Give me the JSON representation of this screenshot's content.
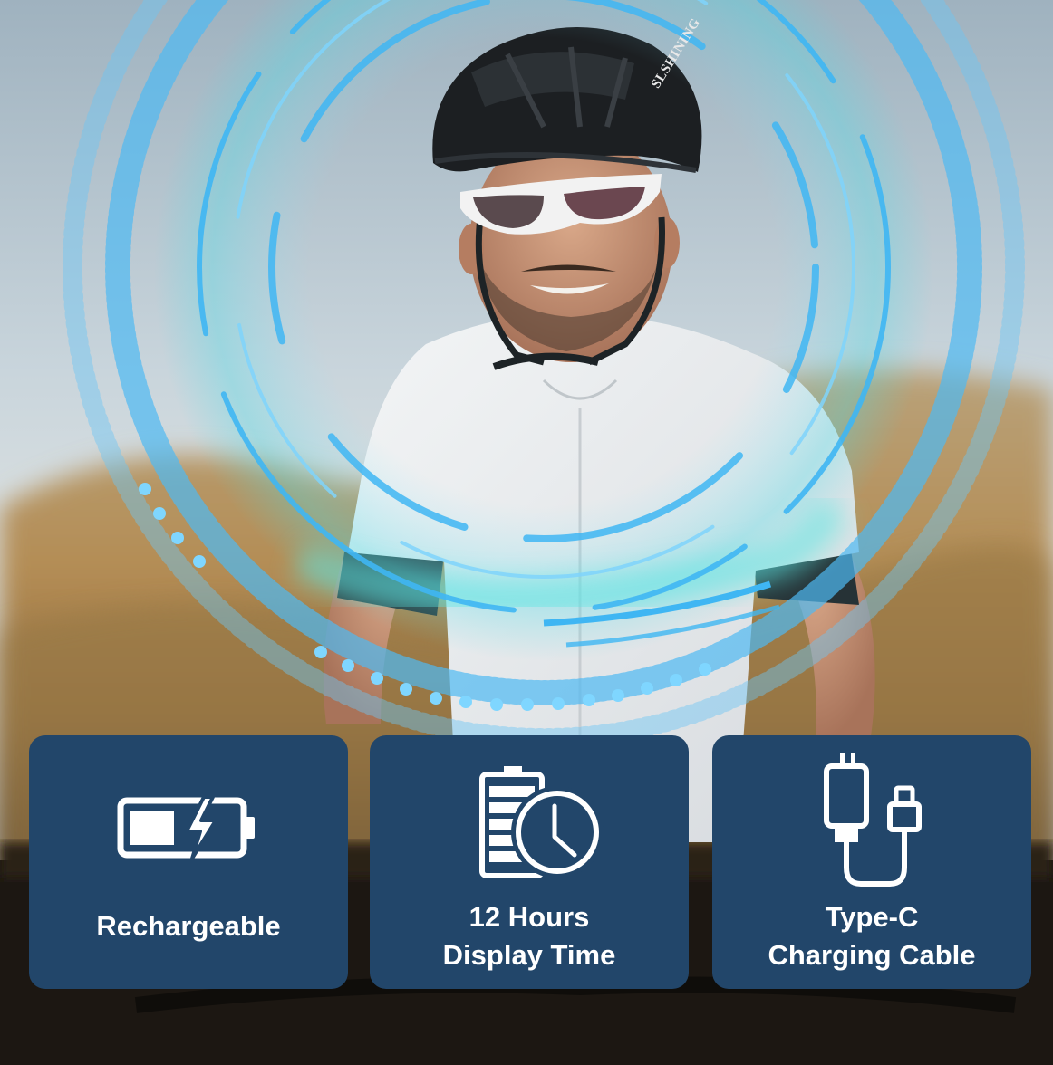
{
  "brand_text": "SLSHINING",
  "colors": {
    "card_background": "#22466a",
    "hud_blue": "#3fb6f3",
    "hud_cyan": "#4fe0e6",
    "label_text": "#ffffff"
  },
  "features": [
    {
      "icon": "battery-charging-icon",
      "lines": [
        "Rechargeable"
      ]
    },
    {
      "icon": "battery-clock-icon",
      "lines": [
        "12 Hours",
        "Display Time"
      ]
    },
    {
      "icon": "type-c-cable-icon",
      "lines": [
        "Type-C",
        "Charging Cable"
      ]
    }
  ]
}
